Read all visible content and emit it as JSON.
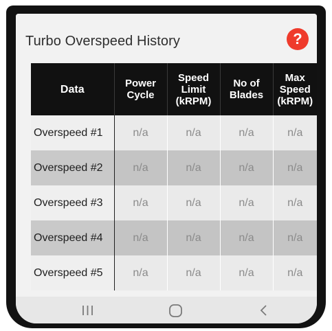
{
  "header": {
    "title": "Turbo Overspeed History",
    "help_symbol": "?"
  },
  "table": {
    "columns": [
      "Data",
      "Power\nCycle",
      "Speed\nLimit\n(kRPM)",
      "No of\nBlades",
      "Max\nSpeed\n(kRPM)"
    ],
    "rows": [
      {
        "label": "Overspeed #1",
        "cells": [
          "n/a",
          "n/a",
          "n/a",
          "n/a"
        ]
      },
      {
        "label": "Overspeed #2",
        "cells": [
          "n/a",
          "n/a",
          "n/a",
          "n/a"
        ]
      },
      {
        "label": "Overspeed #3",
        "cells": [
          "n/a",
          "n/a",
          "n/a",
          "n/a"
        ]
      },
      {
        "label": "Overspeed #4",
        "cells": [
          "n/a",
          "n/a",
          "n/a",
          "n/a"
        ]
      },
      {
        "label": "Overspeed #5",
        "cells": [
          "n/a",
          "n/a",
          "n/a",
          "n/a"
        ]
      }
    ]
  },
  "nav": {
    "icons": [
      "recent-apps-icon",
      "home-icon",
      "back-icon"
    ]
  },
  "colors": {
    "header_bg": "#111111",
    "help_red": "#ef3b2c",
    "row_light": "#efefef",
    "row_dark": "#c9c9c9"
  }
}
